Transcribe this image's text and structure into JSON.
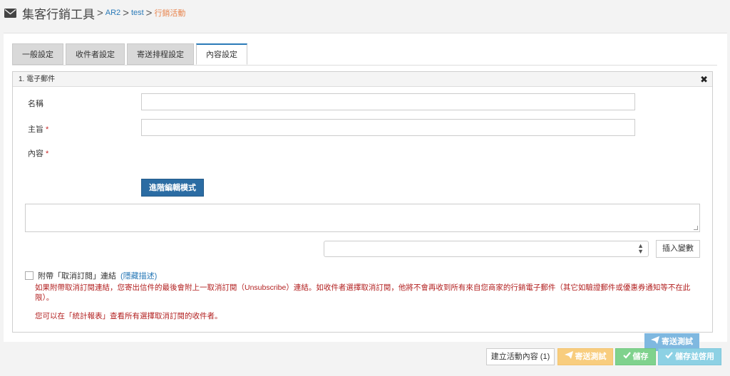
{
  "header": {
    "title": "集客行銷工具",
    "separator": ">",
    "crumbs": [
      "AR2",
      "test"
    ],
    "current": "行銷活動"
  },
  "tabs": [
    {
      "label": "一般設定",
      "active": false
    },
    {
      "label": "收件者設定",
      "active": false
    },
    {
      "label": "寄送排程設定",
      "active": false
    },
    {
      "label": "內容設定",
      "active": true
    }
  ],
  "section": {
    "title": "1. 電子郵件",
    "close_glyph": "✖"
  },
  "form": {
    "name_label": "名稱",
    "subject_label": "主旨",
    "content_label": "內容",
    "required_mark": "*",
    "name_value": "",
    "subject_value": "",
    "advanced_button": "進階編輯模式",
    "body_value": "",
    "variable_select_value": "",
    "insert_variable_button": "插入變數"
  },
  "unsubscribe": {
    "label": "附帶「取消訂閱」連結",
    "hide_link": "(隱藏描述)",
    "checked": false,
    "note1": "如果附帶取消訂閱連結，您寄出信件的最後會附上一取消訂閱（Unsubscribe）連結。如收件者選擇取消訂閱，他將不會再收到所有來自您商家的行銷電子郵件（其它如驗證郵件或優惠券通知等不在此限）。",
    "note2": "您可以在「統計報表」查看所有選擇取消訂閱的收件者。"
  },
  "send_test_button": "寄送測試",
  "footer": {
    "build_content": "建立活動內容 (1)",
    "send_test": "寄送測試",
    "save": "儲存",
    "save_enable": "儲存並啓用"
  },
  "colors": {
    "primary": "#2b6ca3",
    "link": "#2a7ab8",
    "current_crumb": "#e8844d",
    "note_red": "#b21f1f",
    "send_test_blue": "#7fb8e0",
    "send_test_orange": "#f8cd7e",
    "save_green": "#7fd28d",
    "save_enable_cyan": "#8dd1e4"
  },
  "icons": {
    "header": "envelope-icon",
    "send": "paper-plane-icon",
    "save": "check-icon"
  }
}
